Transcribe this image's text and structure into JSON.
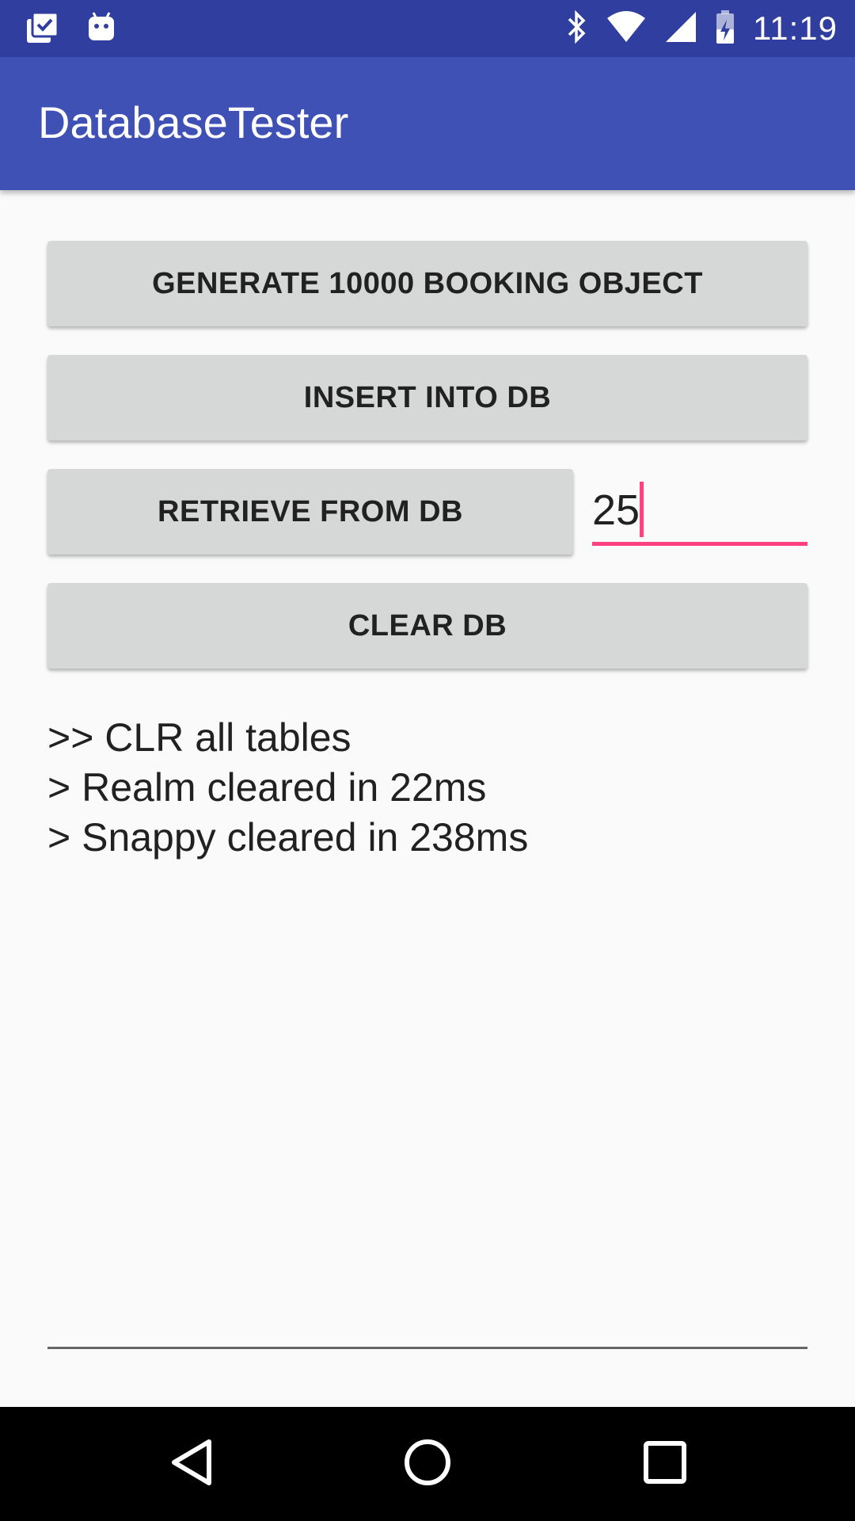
{
  "status_bar": {
    "time": "11:19",
    "icons": [
      "clipboard-check-icon",
      "android-icon",
      "bluetooth-icon",
      "wifi-icon",
      "signal-icon",
      "battery-icon"
    ]
  },
  "app_bar": {
    "title": "DatabaseTester"
  },
  "buttons": {
    "generate_label": "GENERATE 10000 BOOKING OBJECT",
    "insert_label": "INSERT INTO DB",
    "retrieve_label": "RETRIEVE FROM DB",
    "clear_label": "CLEAR DB"
  },
  "count_input": {
    "value": "25"
  },
  "log": {
    "lines": [
      ">> CLR all tables",
      "> Realm cleared in 22ms",
      "> Snappy cleared in 238ms"
    ]
  },
  "nav_bar": {
    "icons": [
      "back-icon",
      "home-icon",
      "recents-icon"
    ]
  },
  "colors": {
    "status_bar": "#303f9f",
    "app_bar": "#3f51b5",
    "accent": "#ff4081",
    "button": "#d6d7d7",
    "background": "#fafafa"
  }
}
